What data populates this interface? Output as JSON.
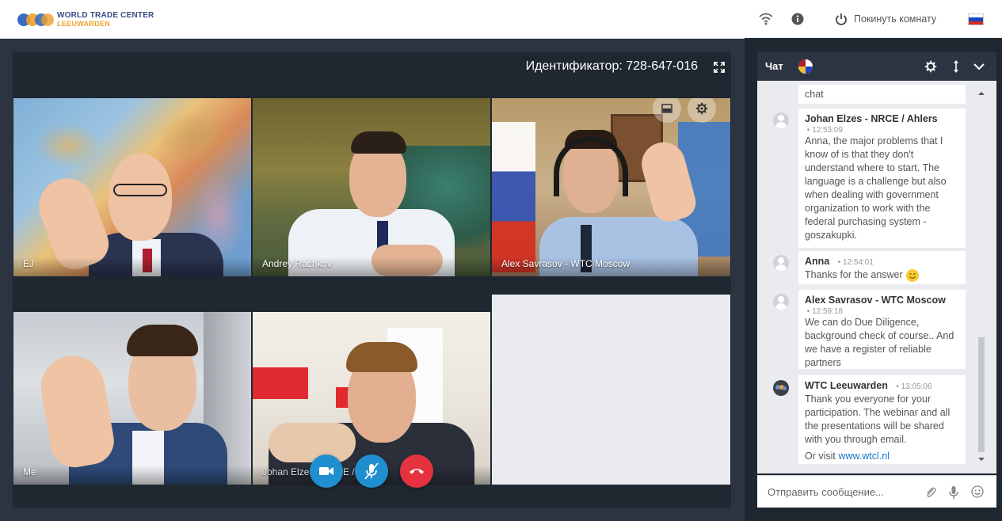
{
  "brand": {
    "line1": "WORLD TRADE CENTER",
    "line2": "LEEUWARDEN"
  },
  "topbar": {
    "wifi_icon": "wifi-icon",
    "info_icon": "info-icon",
    "leave_label": "Покинуть комнату",
    "language_flag": "ru-flag"
  },
  "conference": {
    "identifier_label": "Идентификатор: 728-647-016",
    "participants": [
      {
        "name": "EJ"
      },
      {
        "name": "Andrey Rachkov"
      },
      {
        "name": "Alex Savrasov - WTC Moscow"
      },
      {
        "name": "Me"
      },
      {
        "name": "Johan Elzes - NRCE / Ahlers"
      }
    ],
    "controls": [
      "camera",
      "microphone-muted",
      "hang-up"
    ]
  },
  "chat": {
    "title": "Чат",
    "messages": [
      {
        "text": "chat"
      },
      {
        "author": "Johan Elzes - NRCE / Ahlers",
        "time": "12:53:09",
        "text": "Anna, the major problems that I know of is that they don't understand where to start. The language is a challenge but also when dealing with government organization to work with the federal purchasing system - goszakupki."
      },
      {
        "author": "Anna",
        "time": "12:54:01",
        "text": "Thanks for the answer"
      },
      {
        "author": "Alex Savrasov - WTC Moscow",
        "time": "12:59:18",
        "text": "We can do Due Diligence, background check of course.. And we have a register of reliable partners"
      },
      {
        "author": "WTC Leeuwarden",
        "time": "13:05:06",
        "text": "Thank you everyone for your participation. The webinar and all the presentations will be shared with you through email.",
        "link_prefix": "Or visit",
        "link_text": "www.wtcl.nl"
      }
    ],
    "input_placeholder": "Отправить сообщение..."
  },
  "colors": {
    "accent_camera": "#1f8fcf",
    "accent_hangup": "#e5323f",
    "link": "#1a73c9",
    "panel_dark": "#1f2731"
  }
}
